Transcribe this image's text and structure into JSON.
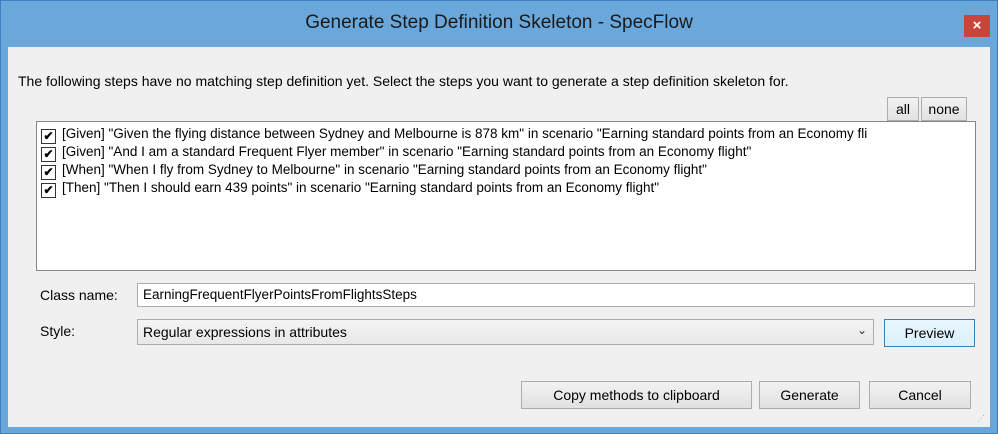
{
  "window": {
    "title": "Generate Step Definition Skeleton - SpecFlow",
    "close_label": "×"
  },
  "instruction": "The following steps have no matching step definition yet. Select the steps you want to generate a step definition skeleton for.",
  "selection_buttons": {
    "all": "all",
    "none": "none"
  },
  "steps": [
    {
      "checked": true,
      "text": "[Given] \"Given the flying distance between Sydney and Melbourne is 878 km\" in scenario \"Earning standard points from an Economy fli"
    },
    {
      "checked": true,
      "text": "[Given] \"And I am a standard Frequent Flyer member\" in scenario \"Earning standard points from an Economy flight\""
    },
    {
      "checked": true,
      "text": "[When] \"When I fly from Sydney to Melbourne\" in scenario \"Earning standard points from an Economy flight\""
    },
    {
      "checked": true,
      "text": "[Then] \"Then I should earn 439 points\" in scenario \"Earning standard points from an Economy flight\""
    }
  ],
  "class_name": {
    "label": "Class name:",
    "value": "EarningFrequentFlyerPointsFromFlightsSteps"
  },
  "style": {
    "label": "Style:",
    "selected": "Regular expressions in attributes"
  },
  "buttons": {
    "preview": "Preview",
    "copy": "Copy methods to clipboard",
    "generate": "Generate",
    "cancel": "Cancel"
  },
  "icons": {
    "checkmark": "✔",
    "dropdown": "chevron-down-icon",
    "close": "close-icon"
  }
}
